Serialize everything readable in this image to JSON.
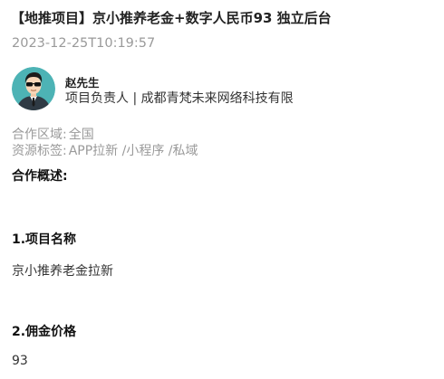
{
  "post": {
    "title": "【地推项目】京小推养老金+数字人民币93 独立后台",
    "timestamp": "2023-12-25T10:19:57"
  },
  "author": {
    "avatar_icon": "person-with-sunglasses-avatar",
    "name": "赵先生",
    "role": "项目负责人 | 成都青梵未来网络科技有限"
  },
  "meta": {
    "region_label": "合作区域:",
    "region_value": "全国",
    "tags_label": "资源标签:",
    "tags_value": "APP拉新 /小程序 /私域"
  },
  "overview": {
    "heading": "合作概述:",
    "sections": [
      {
        "heading": "1.项目名称",
        "text": "京小推养老金拉新"
      },
      {
        "heading": "2.佣金价格",
        "text": "93"
      }
    ]
  },
  "colors": {
    "avatar_bg": "#4db3b5",
    "muted_text": "#9a9a9a"
  }
}
